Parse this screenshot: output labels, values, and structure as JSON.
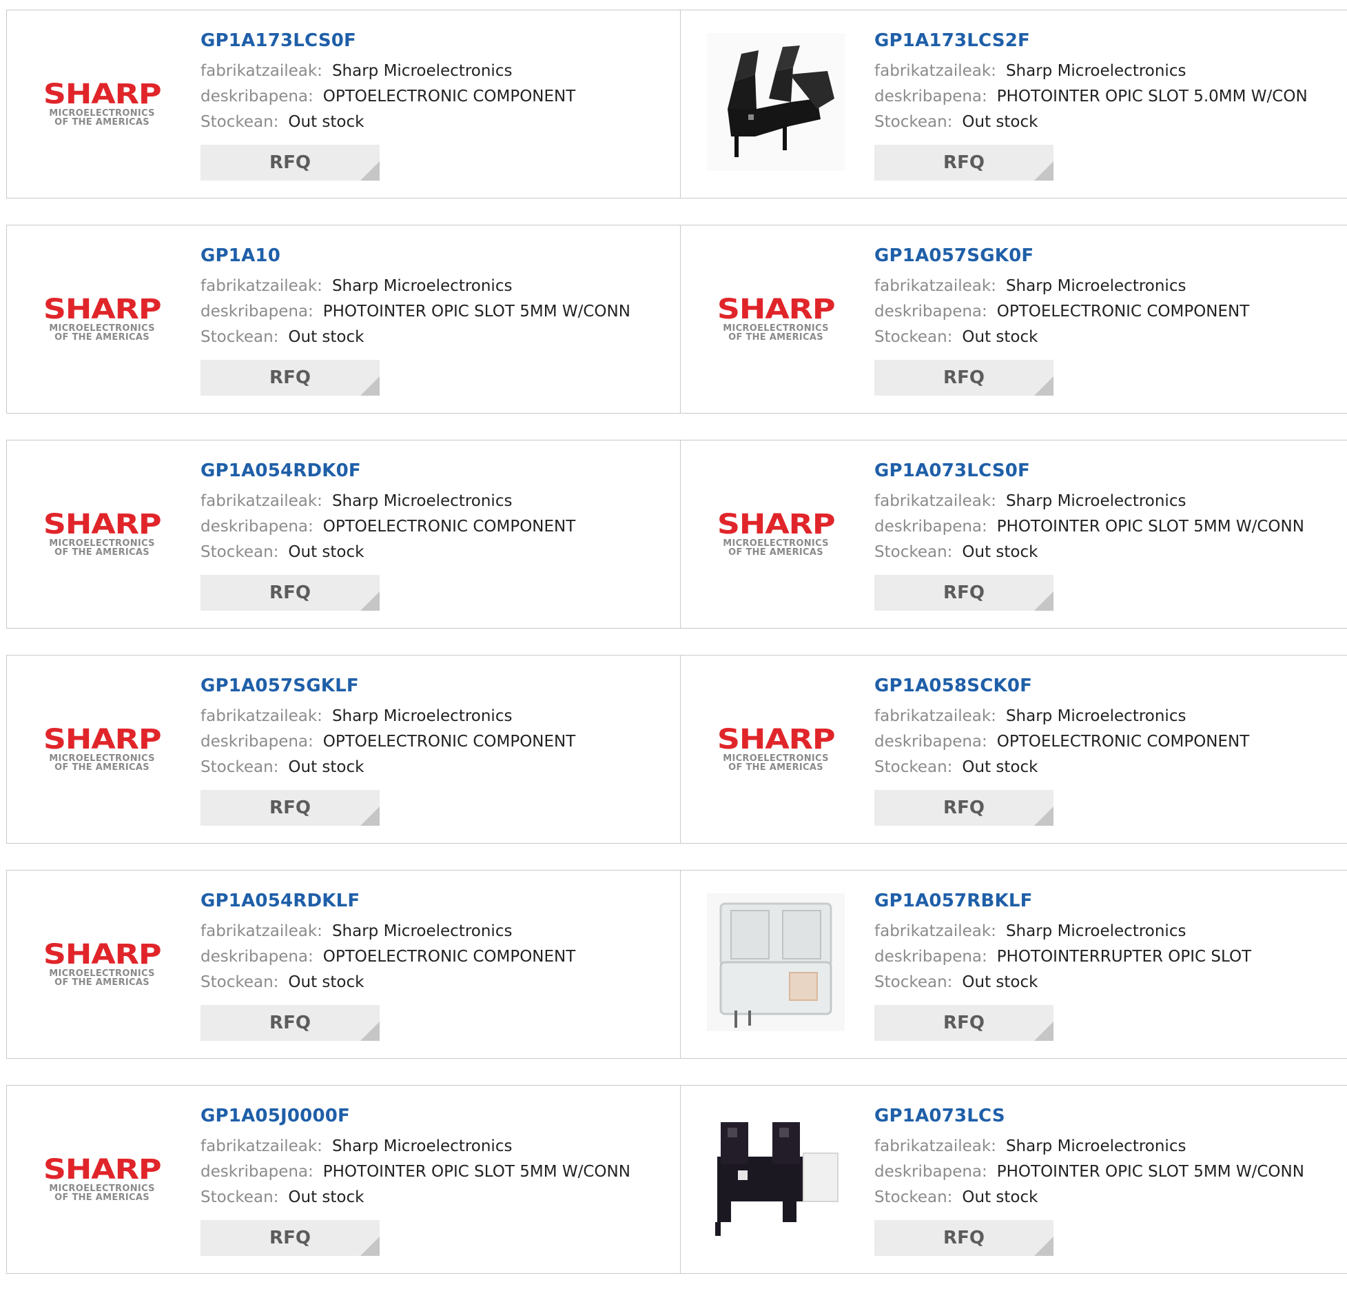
{
  "labels": {
    "manufacturer": "fabrikatzaileak:",
    "description": "deskribapena:",
    "stock": "Stockean:",
    "rfq": "RFQ"
  },
  "logo": {
    "wordmark": "SHARP",
    "line1": "MICROELECTRONICS",
    "line2": "OF THE AMERICAS"
  },
  "colors": {
    "part_link": "#1f5fa8",
    "brand_red": "#e0252a",
    "rfq_bg": "#ececec"
  },
  "products": [
    {
      "part": "GP1A173LCS0F",
      "manufacturer": "Sharp Microelectronics",
      "description": "OPTOELECTRONIC COMPONENT",
      "stock": "Out stock",
      "image": "sharp-logo"
    },
    {
      "part": "GP1A173LCS2F",
      "manufacturer": "Sharp Microelectronics",
      "description": "PHOTOINTER OPIC SLOT 5.0MM W/CON",
      "stock": "Out stock",
      "image": "black-photointerrupter-photo"
    },
    {
      "part": "GP1A10",
      "manufacturer": "Sharp Microelectronics",
      "description": "PHOTOINTER OPIC SLOT 5MM W/CONN",
      "stock": "Out stock",
      "image": "sharp-logo"
    },
    {
      "part": "GP1A057SGK0F",
      "manufacturer": "Sharp Microelectronics",
      "description": "OPTOELECTRONIC COMPONENT",
      "stock": "Out stock",
      "image": "sharp-logo"
    },
    {
      "part": "GP1A054RDK0F",
      "manufacturer": "Sharp Microelectronics",
      "description": "OPTOELECTRONIC COMPONENT",
      "stock": "Out stock",
      "image": "sharp-logo"
    },
    {
      "part": "GP1A073LCS0F",
      "manufacturer": "Sharp Microelectronics",
      "description": "PHOTOINTER OPIC SLOT 5MM W/CONN",
      "stock": "Out stock",
      "image": "sharp-logo"
    },
    {
      "part": "GP1A057SGKLF",
      "manufacturer": "Sharp Microelectronics",
      "description": "OPTOELECTRONIC COMPONENT",
      "stock": "Out stock",
      "image": "sharp-logo"
    },
    {
      "part": "GP1A058SCK0F",
      "manufacturer": "Sharp Microelectronics",
      "description": "OPTOELECTRONIC COMPONENT",
      "stock": "Out stock",
      "image": "sharp-logo"
    },
    {
      "part": "GP1A054RDKLF",
      "manufacturer": "Sharp Microelectronics",
      "description": "OPTOELECTRONIC COMPONENT",
      "stock": "Out stock",
      "image": "sharp-logo"
    },
    {
      "part": "GP1A057RBKLF",
      "manufacturer": "Sharp Microelectronics",
      "description": "PHOTOINTERRUPTER OPIC SLOT",
      "stock": "Out stock",
      "image": "clear-photointerrupter-photo"
    },
    {
      "part": "GP1A05J0000F",
      "manufacturer": "Sharp Microelectronics",
      "description": "PHOTOINTER OPIC SLOT 5MM W/CONN",
      "stock": "Out stock",
      "image": "sharp-logo"
    },
    {
      "part": "GP1A073LCS",
      "manufacturer": "Sharp Microelectronics",
      "description": "PHOTOINTER OPIC SLOT 5MM W/CONN",
      "stock": "Out stock",
      "image": "dark-photointerrupter-photo"
    }
  ]
}
